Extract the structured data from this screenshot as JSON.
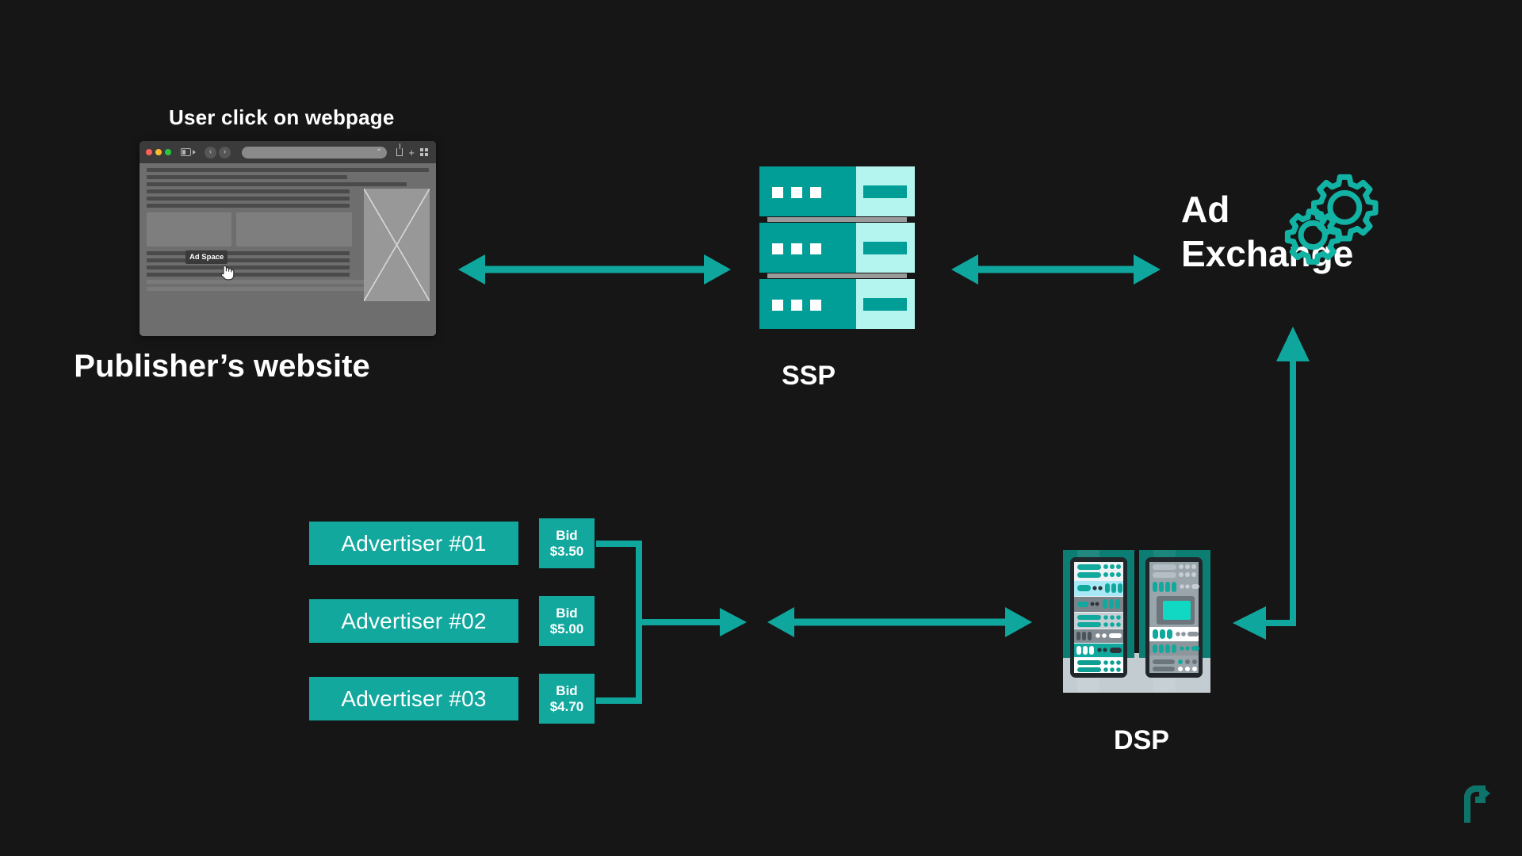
{
  "theme": {
    "background": "#161616",
    "accent_teal": "#13a89e",
    "accent_deep": "#009e96",
    "accent_light": "#b5f5ef",
    "text": "#ffffff"
  },
  "diagram": {
    "title_caption": "User click on webpage",
    "nodes": {
      "publisher": {
        "label": "Publisher’s website",
        "browser": {
          "traffic_lights": [
            "close-red",
            "minimize-yellow",
            "zoom-green"
          ],
          "sidebar_icon": "sidebar-icon",
          "back_glyph": "‹",
          "forward_glyph": "›",
          "url_value": "",
          "url_placeholder": "",
          "right_icons": [
            "share-icon",
            "new-tab-icon",
            "tab-overview-icon"
          ]
        },
        "ad_slot": {
          "tooltip": "Ad Space",
          "cursor": "pointer-hand-cursor"
        }
      },
      "ssp": {
        "label": "SSP",
        "icon": "server-stack-icon",
        "rows": 3
      },
      "ad_exchange": {
        "label": "Ad\nExchange",
        "icon": "gears-icon"
      },
      "dsp": {
        "label": "DSP",
        "icon": "server-rack-icon"
      }
    },
    "advertisers": [
      {
        "name": "Advertiser #01",
        "bid_label": "Bid",
        "bid_value": "$3.50"
      },
      {
        "name": "Advertiser #02",
        "bid_label": "Bid",
        "bid_value": "$5.00"
      },
      {
        "name": "Advertiser #03",
        "bid_label": "Bid",
        "bid_value": "$4.70"
      }
    ],
    "connectors": [
      {
        "name": "publisher-ssp",
        "style": "double-arrow-horizontal"
      },
      {
        "name": "ssp-adexchange",
        "style": "double-arrow-horizontal"
      },
      {
        "name": "bids-bracket",
        "style": "bracket-right-arrow"
      },
      {
        "name": "bids-dsp",
        "style": "double-arrow-horizontal"
      },
      {
        "name": "dsp-adexchange",
        "style": "elbow-double-arrow"
      }
    ],
    "watermark": "p-arrow-logo"
  }
}
